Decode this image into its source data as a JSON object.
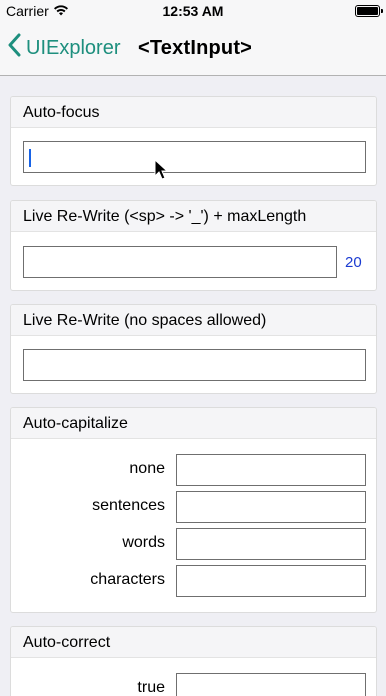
{
  "status_bar": {
    "carrier": "Carrier",
    "time": "12:53 AM"
  },
  "nav": {
    "back_label": "UIExplorer",
    "title": "<TextInput>"
  },
  "sections": {
    "auto_focus": {
      "title": "Auto-focus"
    },
    "live_rewrite_max": {
      "title": "Live Re-Write (<sp>  ->  '_') + maxLength",
      "counter": "20"
    },
    "live_rewrite_nospace": {
      "title": "Live Re-Write (no spaces allowed)"
    },
    "auto_capitalize": {
      "title": "Auto-capitalize",
      "rows": [
        "none",
        "sentences",
        "words",
        "characters"
      ]
    },
    "auto_correct": {
      "title": "Auto-correct",
      "rows": [
        "true"
      ]
    }
  },
  "colors": {
    "accent": "#1e8f7e",
    "counter": "#1b3bd1",
    "cursor": "#1863e6"
  }
}
